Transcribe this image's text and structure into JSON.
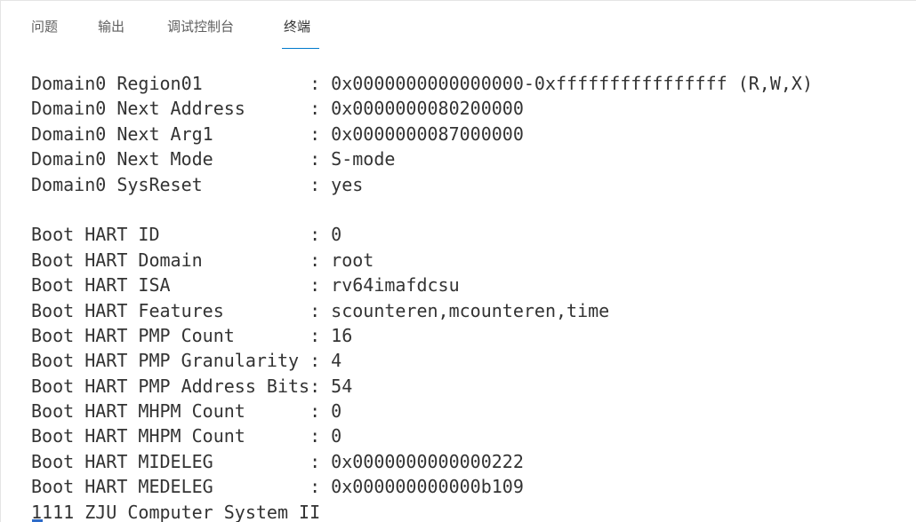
{
  "tabs": [
    {
      "label": "问题"
    },
    {
      "label": "输出"
    },
    {
      "label": "调试控制台"
    },
    {
      "label": "终端",
      "active": true
    }
  ],
  "terminal": {
    "lines": [
      "Domain0 Region01          : 0x0000000000000000-0xffffffffffffffff (R,W,X)",
      "Domain0 Next Address      : 0x0000000080200000",
      "Domain0 Next Arg1         : 0x0000000087000000",
      "Domain0 Next Mode         : S-mode",
      "Domain0 SysReset          : yes",
      "",
      "Boot HART ID              : 0",
      "Boot HART Domain          : root",
      "Boot HART ISA             : rv64imafdcsu",
      "Boot HART Features        : scounteren,mcounteren,time",
      "Boot HART PMP Count       : 16",
      "Boot HART PMP Granularity : 4",
      "Boot HART PMP Address Bits: 54",
      "Boot HART MHPM Count      : 0",
      "Boot HART MHPM Count      : 0",
      "Boot HART MIDELEG         : 0x0000000000000222",
      "Boot HART MEDELEG         : 0x000000000000b109",
      "1111 ZJU Computer System II"
    ]
  },
  "colors": {
    "tab_active_underline": "#007acc",
    "terminal_text": "#333333",
    "cursor": "#2d6bc9"
  }
}
